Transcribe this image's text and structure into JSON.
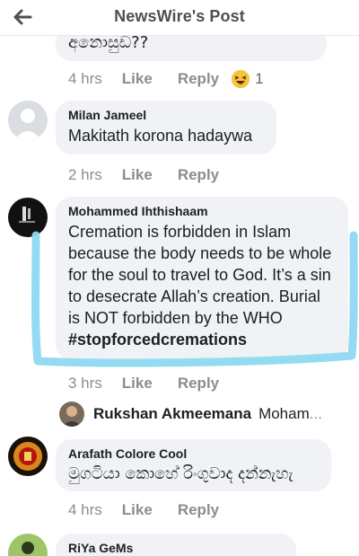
{
  "header": {
    "title": "NewsWire's Post"
  },
  "comments": [
    {
      "text": "අනොසුඩ??",
      "time": "4 hrs",
      "like": "Like",
      "reply": "Reply",
      "reaction_count": "1",
      "reaction_icon": "laughing-emoji-icon"
    },
    {
      "author": "Milan Jameel",
      "text": "Makitath korona hadaywa",
      "time": "2 hrs",
      "like": "Like",
      "reply": "Reply"
    },
    {
      "author": "Mohammed Ihthishaam",
      "text": "Cremation is forbidden in Islam because the body needs to be whole for the soul to travel to God. It’s a sin to desecrate Allah’s creation. Burial is NOT forbidden by the WHO ",
      "hashtag": "#stopforcedcremations",
      "time": "3 hrs",
      "like": "Like",
      "reply": "Reply"
    },
    {
      "author": "Arafath Colore Cool",
      "text": "මුගටියා කොහේ රිංගුවාද දන්නැහැ",
      "time": "4 hrs",
      "like": "Like",
      "reply": "Reply"
    },
    {
      "author": "RiYa GeMs"
    }
  ],
  "nested_reply": {
    "author": "Rukshan Akmeemana",
    "snippet": "Moham",
    "ellipsis": "..."
  },
  "colors": {
    "highlight": "#8fd8f2",
    "bubble": "#f0f2f5",
    "meta": "#8a8d91"
  }
}
